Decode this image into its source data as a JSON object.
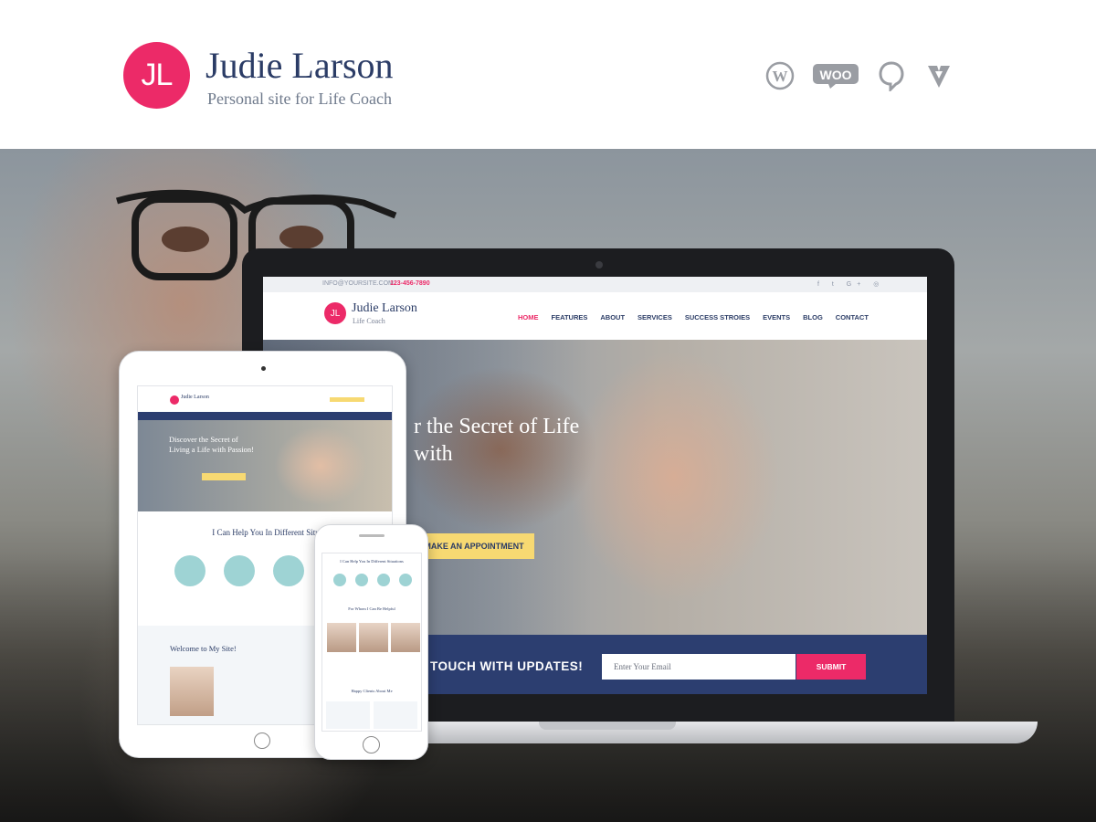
{
  "header": {
    "logo_initials": "JL",
    "title": "Judie Larson",
    "subtitle": "Personal site for Life Coach",
    "platform_icons": [
      "wordpress-icon",
      "woocommerce-icon",
      "revslider-icon",
      "visual-composer-icon"
    ],
    "woo_text": "WOO"
  },
  "colors": {
    "accent": "#ec2a68",
    "navy": "#2b3c66",
    "yellow": "#f7d972",
    "teal": "#9ed3d4"
  },
  "laptop_site": {
    "topbar": {
      "email": "INFO@YOURSITE.COM",
      "phone": "123-456-7890",
      "social": "f  t  G+  ◎"
    },
    "logo_initials": "JL",
    "title": "Judie Larson",
    "subtitle": "Life Coach",
    "menu": [
      "HOME",
      "FEATURES",
      "ABOUT",
      "SERVICES",
      "SUCCESS STROIES",
      "EVENTS",
      "BLOG",
      "CONTACT"
    ],
    "hero_headline": "r the Secret of Life with",
    "cta": "MAKE AN APPOINTMENT",
    "subscribe_text": "TOUCH WITH UPDATES!",
    "email_placeholder": "Enter Your Email",
    "submit": "SUBMIT"
  },
  "tablet_site": {
    "title": "Judie Larson",
    "hero_text": "Discover the Secret of Living a Life with Passion!",
    "section_title": "I Can Help You In Different Situ",
    "welcome_title": "Welcome to My Site!"
  },
  "phone_site": {
    "section_title": "I Can Help You In Different Situations",
    "helpful_title": "For Whom I Can Be Helpful",
    "clients_title": "Happy Clients About Me"
  }
}
